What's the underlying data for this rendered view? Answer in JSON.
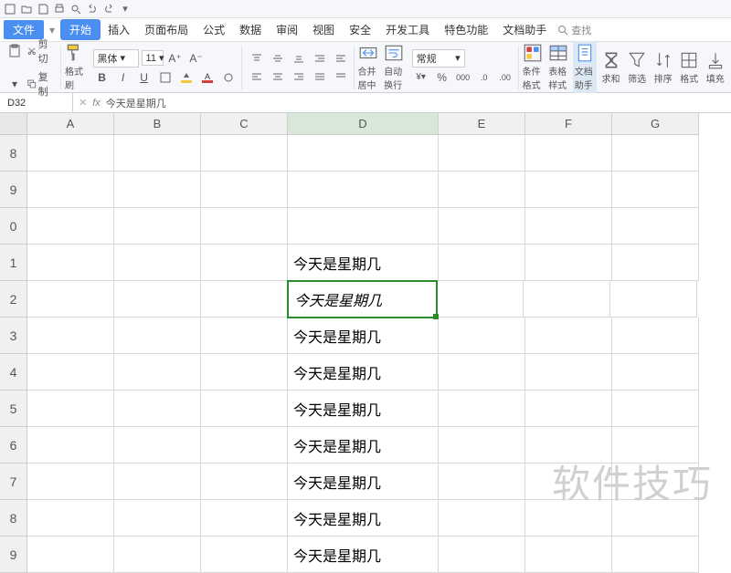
{
  "menu": {
    "file": "文件",
    "tabs": [
      "开始",
      "插入",
      "页面布局",
      "公式",
      "数据",
      "审阅",
      "视图",
      "安全",
      "开发工具",
      "特色功能",
      "文档助手"
    ],
    "search": "查找"
  },
  "clipboard": {
    "cut": "剪切",
    "copy": "复制",
    "paste": "格式刷"
  },
  "font": {
    "name": "黑体",
    "size": "11"
  },
  "align": {
    "merge": "合并居中",
    "wrap": "自动换行"
  },
  "number": {
    "format": "常规"
  },
  "styles": {
    "cond": "条件格式",
    "tbl": "表格样式"
  },
  "tools": {
    "doc": "文档助手",
    "sum": "求和",
    "filter": "筛选",
    "sort": "排序",
    "fmt": "格式",
    "fill": "填充"
  },
  "formula": {
    "ref": "D32",
    "fx": "fx",
    "value": "今天是星期几"
  },
  "cols": [
    "A",
    "B",
    "C",
    "D",
    "E",
    "F",
    "G"
  ],
  "rows": [
    "8",
    "9",
    "0",
    "1",
    "2",
    "3",
    "4",
    "5",
    "6",
    "7",
    "8",
    "9"
  ],
  "cells": {
    "r3": {
      "D": "今天是星期几"
    },
    "r4": {
      "D": "今天是星期几"
    },
    "r5": {
      "D": "今天是星期几"
    },
    "r6": {
      "D": "今天是星期几"
    },
    "r7": {
      "D": "今天是星期几"
    },
    "r8": {
      "D": "今天是星期几"
    },
    "r9": {
      "D": "今天是星期几"
    },
    "r10": {
      "D": "今天是星期几"
    },
    "r11": {
      "D": "今天是星期几"
    }
  },
  "watermark": "软件技巧"
}
